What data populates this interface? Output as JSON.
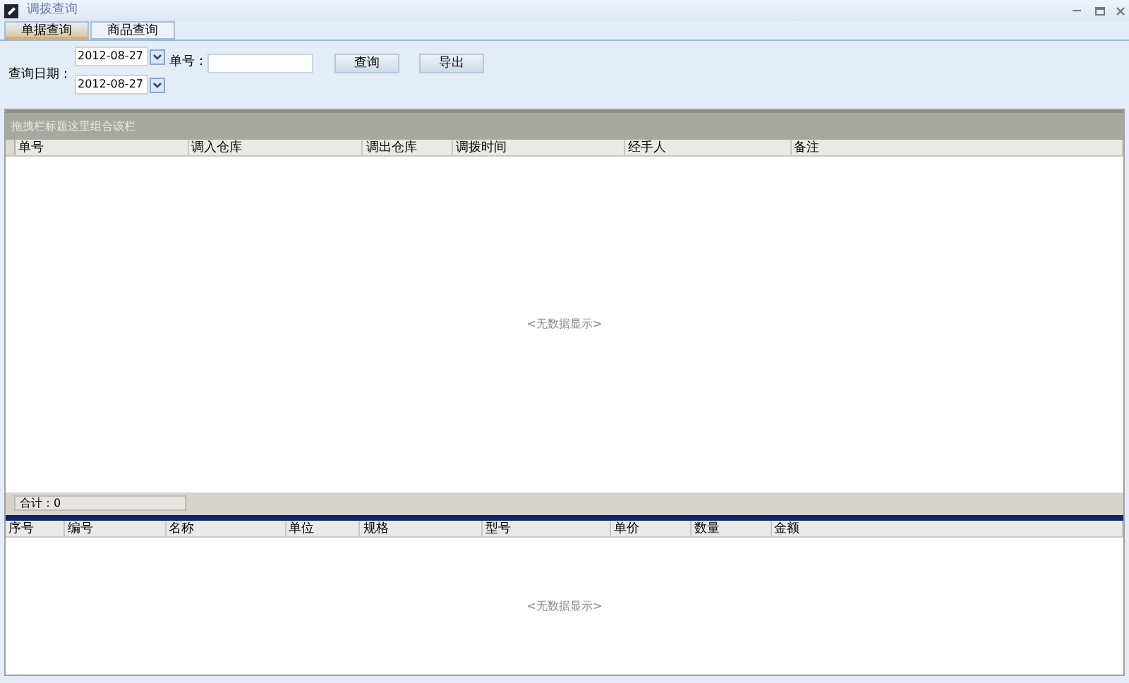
{
  "window": {
    "title": "调拨查询"
  },
  "tabs": [
    {
      "label": "单据查询",
      "selected": true
    },
    {
      "label": "商品查询",
      "selected": false
    }
  ],
  "filters": {
    "date_label": "查询日期：",
    "date_from": "2012-08-27",
    "date_to": "2012-08-27",
    "number_label": "单号：",
    "search_button": "查询",
    "export_button": "导出"
  },
  "main_grid": {
    "group_panel": "拖拽栏标题这里组合该栏",
    "columns": [
      "单号",
      "调入仓库",
      "调出仓库",
      "调拨时间",
      "经手人",
      "备注"
    ],
    "empty_text": "<无数据显示>",
    "footer": "合计：0"
  },
  "detail_grid": {
    "columns": [
      "序号",
      "编号",
      "名称",
      "单位",
      "规格",
      "型号",
      "单价",
      "数量",
      "金额"
    ],
    "empty_text": "<无数据显示>"
  }
}
